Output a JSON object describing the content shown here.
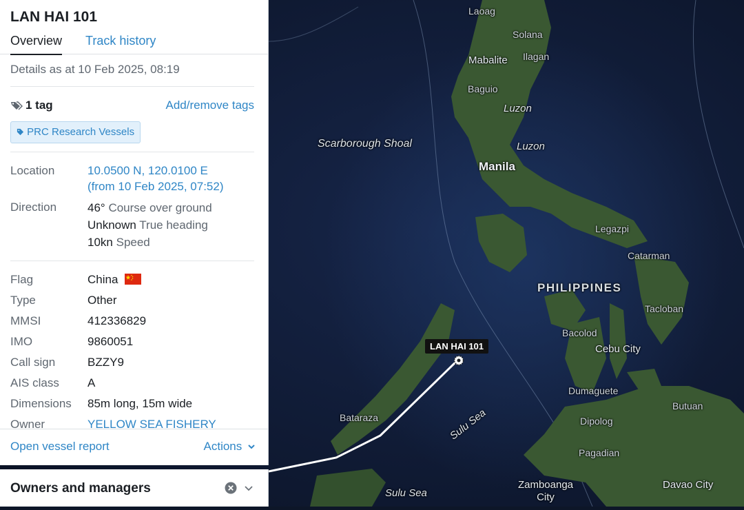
{
  "vessel": {
    "name": "LAN HAI 101",
    "tabs": [
      "Overview",
      "Track history"
    ],
    "details_as_at": "Details as at 10 Feb 2025, 08:19",
    "tag_count": "1 tag",
    "add_remove_tags": "Add/remove tags",
    "tag_chip": "PRC Research Vessels",
    "location": {
      "label": "Location",
      "coords": "10.0500 N, 120.0100 E",
      "since": "(from 10 Feb 2025, 07:52)"
    },
    "direction": {
      "label": "Direction",
      "course_value": "46°",
      "course_label": "Course over ground",
      "heading_value": "Unknown",
      "heading_label": "True heading",
      "speed_value": "10kn",
      "speed_label": "Speed"
    },
    "fields": [
      {
        "label": "Flag",
        "value": "China"
      },
      {
        "label": "Type",
        "value": "Other"
      },
      {
        "label": "MMSI",
        "value": "412336829"
      },
      {
        "label": "IMO",
        "value": "9860051"
      },
      {
        "label": "Call sign",
        "value": "BZZY9"
      },
      {
        "label": "AIS class",
        "value": "A"
      },
      {
        "label": "Dimensions",
        "value": "85m long, 15m wide"
      },
      {
        "label": "Owner",
        "value": "YELLOW SEA FISHERY"
      }
    ],
    "open_report": "Open vessel report",
    "actions": "Actions"
  },
  "owners_bar": {
    "title": "Owners and managers"
  },
  "map": {
    "vessel_tag": "LAN HAI 101",
    "labels": {
      "laoag": "Laoag",
      "solana": "Solana",
      "mabalite": "Mabalite",
      "ilagan": "Ilagan",
      "baguio": "Baguio",
      "luzon1": "Luzon",
      "luzon2": "Luzon",
      "scarborough": "Scarborough Shoal",
      "manila": "Manila",
      "legazpi": "Legazpi",
      "catarman": "Catarman",
      "philippines": "PHILIPPINES",
      "tacloban": "Tacloban",
      "bacolod": "Bacolod",
      "cebu": "Cebu City",
      "dumaguete": "Dumaguete",
      "butuan": "Butuan",
      "dipolog": "Dipolog",
      "pagadian": "Pagadian",
      "bataraza": "Bataraza",
      "sulu_sea": "Sulu Sea",
      "sulu_sea2": "Sulu Sea",
      "zamboanga": "Zamboanga City",
      "davao": "Davao City"
    }
  },
  "colors": {
    "link": "#2f86c6",
    "ocean": "#0d1628",
    "land": "#2e4a2a"
  }
}
